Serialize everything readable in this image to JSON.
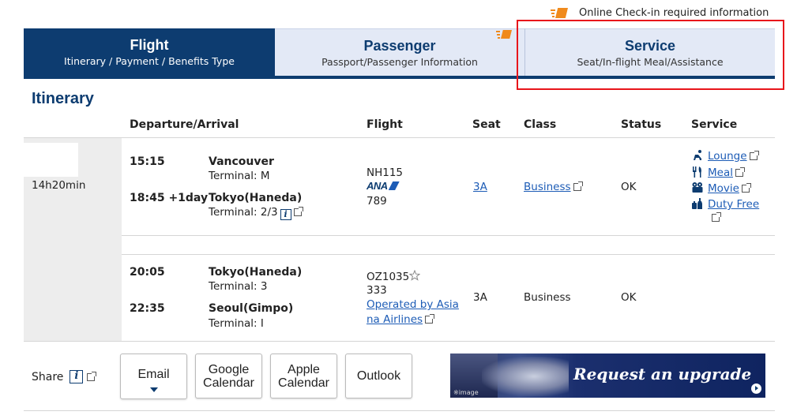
{
  "checkin_note": "Online Check-in required information",
  "tabs": [
    {
      "title": "Flight",
      "sub": "Itinerary / Payment / Benefits Type"
    },
    {
      "title": "Passenger",
      "sub": "Passport/Passenger Information"
    },
    {
      "title": "Service",
      "sub": "Seat/In-flight Meal/Assistance"
    }
  ],
  "section_title": "Itinerary",
  "columns": {
    "dep_arr": "Departure/Arrival",
    "flight": "Flight",
    "seat": "Seat",
    "class": "Class",
    "status": "Status",
    "service": "Service"
  },
  "duration": "14h20min",
  "segments": [
    {
      "dep_time": "15:15",
      "dep_city": "Vancouver",
      "dep_terminal": "Terminal: M",
      "arr_time": "18:45 +1day",
      "arr_city": "Tokyo(Haneda)",
      "arr_terminal": "Terminal: 2/3",
      "flight_no": "NH115",
      "airline_logo": "ANA",
      "aircraft": "789",
      "seat": "3A",
      "class": "Business",
      "status": "OK",
      "services": [
        "Lounge",
        "Meal",
        "Movie",
        "Duty Free"
      ]
    },
    {
      "dep_time": "20:05",
      "dep_city": "Tokyo(Haneda)",
      "dep_terminal": "Terminal: 3",
      "arr_time": "22:35",
      "arr_city": "Seoul(Gimpo)",
      "arr_terminal": "Terminal: I",
      "flight_no": "OZ1035",
      "aircraft": "333",
      "operated_line1": "Operated by Asia",
      "operated_line2": "na Airlines",
      "seat": "3A",
      "class": "Business",
      "status": "OK"
    }
  ],
  "share": {
    "label": "Share",
    "buttons": {
      "email": "Email",
      "google_1": "Google",
      "google_2": "Calendar",
      "apple_1": "Apple",
      "apple_2": "Calendar",
      "outlook": "Outlook"
    }
  },
  "upgrade": {
    "label": "Request an upgrade",
    "image_tag": "※image"
  },
  "icons": [
    "ticket-icon",
    "info-icon",
    "external-link-icon",
    "lounge-icon",
    "meal-icon",
    "movie-icon",
    "duty-free-icon",
    "star-alliance-icon",
    "chevron-down-icon",
    "arrow-right-icon"
  ],
  "colors": {
    "navy": "#0d3c70",
    "tab_light": "#e3e9f6",
    "accent_orange": "#f08a1c",
    "highlight_red": "#e8151b",
    "link": "#1d5cb6"
  }
}
